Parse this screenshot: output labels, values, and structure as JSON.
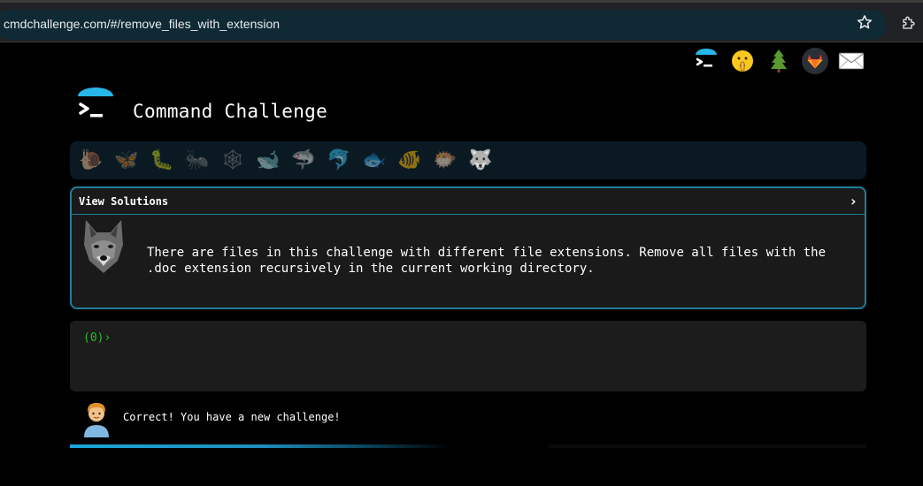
{
  "browser": {
    "url": "cmdchallenge.com/#/remove_files_with_extension"
  },
  "top_icons": [
    {
      "name": "terminal-logo-icon"
    },
    {
      "name": "shushing-face-icon",
      "glyph": "🤫"
    },
    {
      "name": "evergreen-tree-icon",
      "glyph": "🌲"
    },
    {
      "name": "gitlab-icon"
    },
    {
      "name": "envelope-icon",
      "glyph": "✉"
    }
  ],
  "header": {
    "title": "Command Challenge"
  },
  "animals": [
    {
      "name": "snail-icon",
      "glyph": "🐌"
    },
    {
      "name": "butterfly-icon",
      "glyph": "🦋"
    },
    {
      "name": "caterpillar-icon",
      "glyph": "🐛"
    },
    {
      "name": "ant-icon",
      "glyph": "🐜"
    },
    {
      "name": "spider-web-icon",
      "glyph": "🕸"
    },
    {
      "name": "whale-icon",
      "glyph": "🐋"
    },
    {
      "name": "shark-icon",
      "glyph": "🦈"
    },
    {
      "name": "dolphin-icon",
      "glyph": "🐬"
    },
    {
      "name": "fish-icon",
      "glyph": "🐟"
    },
    {
      "name": "tropical-fish-icon",
      "glyph": "🐠"
    },
    {
      "name": "blowfish-icon",
      "glyph": "🐡"
    },
    {
      "name": "wolf-icon",
      "glyph": "🐺"
    }
  ],
  "challenge": {
    "solutions_label": "View Solutions",
    "chevron": "›",
    "description": "There are files in this challenge with different file extensions. Remove all files with the .doc extension recursively in the current working directory."
  },
  "terminal": {
    "prompt": "(0)›"
  },
  "feedback": {
    "message": "Correct! You have a new challenge!"
  },
  "progress": {
    "fraction": 0.6
  },
  "colors": {
    "accent": "#1f7f9a",
    "prompt": "#22c322",
    "progress": "#1aa6d9"
  }
}
